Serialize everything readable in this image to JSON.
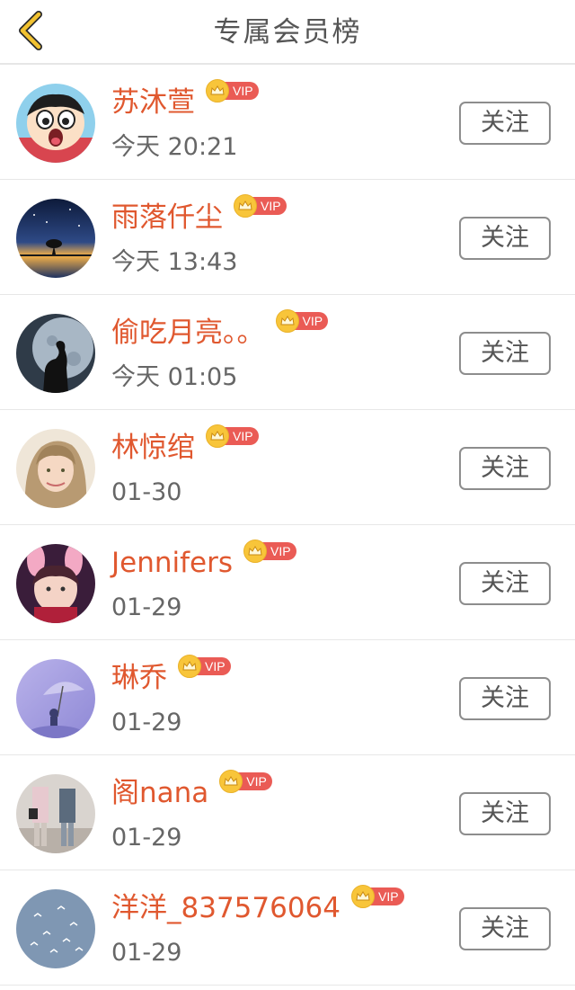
{
  "header": {
    "title": "专属会员榜",
    "back_icon": "chevron-left-icon",
    "accent_color": "#f2c230"
  },
  "vip_label": "VIP",
  "members": [
    {
      "name": "苏沐萱",
      "time": "今天 20:21",
      "follow_label": "关注",
      "avatar": "cartoon-boy-avatar"
    },
    {
      "name": "雨落仟尘",
      "time": "今天 13:43",
      "follow_label": "关注",
      "avatar": "night-sky-tree-avatar"
    },
    {
      "name": "偷吃月亮。。",
      "time": "今天 01:05",
      "follow_label": "关注",
      "avatar": "moon-silhouette-avatar"
    },
    {
      "name": "林惊绾",
      "time": "01-30",
      "follow_label": "关注",
      "avatar": "girl-portrait-avatar"
    },
    {
      "name": "Jennifers",
      "time": "01-29",
      "follow_label": "关注",
      "avatar": "girl-bunny-ears-avatar"
    },
    {
      "name": "琳乔",
      "time": "01-29",
      "follow_label": "关注",
      "avatar": "purple-umbrella-avatar"
    },
    {
      "name": "阁nana",
      "time": "01-29",
      "follow_label": "关注",
      "avatar": "street-couple-avatar"
    },
    {
      "name": "洋洋_837576064",
      "time": "01-29",
      "follow_label": "关注",
      "avatar": "seagulls-sky-avatar"
    }
  ],
  "colors": {
    "name": "#e0582f",
    "vip_badge": "#ea5b55",
    "crown": "#f8c53a"
  }
}
